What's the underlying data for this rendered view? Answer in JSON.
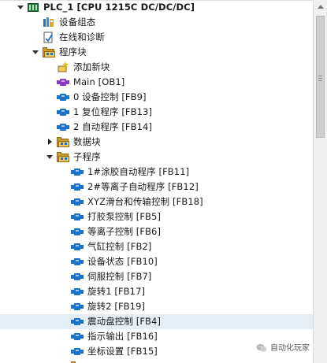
{
  "tree": {
    "plc_title": "PLC_1 [CPU 1215C DC/DC/DC]",
    "items": [
      {
        "label": "设备组态"
      },
      {
        "label": "在线和诊断"
      },
      {
        "label": "程序块"
      },
      {
        "label": "添加新块"
      },
      {
        "label": "Main [OB1]"
      },
      {
        "label": "0 设备控制 [FB9]"
      },
      {
        "label": "1 复位程序 [FB13]"
      },
      {
        "label": "2 自动程序 [FB14]"
      },
      {
        "label": "数据块"
      },
      {
        "label": "子程序"
      },
      {
        "label": "1#涂胶自动程序 [FB11]"
      },
      {
        "label": "2#等离子自动程序 [FB12]"
      },
      {
        "label": "XYZ滑台和传输控制 [FB18]"
      },
      {
        "label": "打胶泵控制 [FB5]"
      },
      {
        "label": "等离子控制 [FB6]"
      },
      {
        "label": "气缸控制 [FB2]"
      },
      {
        "label": "设备状态 [FB10]"
      },
      {
        "label": "伺服控制 [FB7]"
      },
      {
        "label": "旋转1 [FB17]"
      },
      {
        "label": "旋转2 [FB19]"
      },
      {
        "label": "震动盘控制 [FB4]"
      },
      {
        "label": "指示输出 [FB16]"
      },
      {
        "label": "坐标设置 [FB15]"
      }
    ]
  },
  "watermark": {
    "text": "自动化玩家"
  },
  "colors": {
    "selected_row": "#e5eef5",
    "fb_icon": "#1b73c9",
    "ob_icon": "#8a3cc2",
    "folder": "#f0c860"
  }
}
